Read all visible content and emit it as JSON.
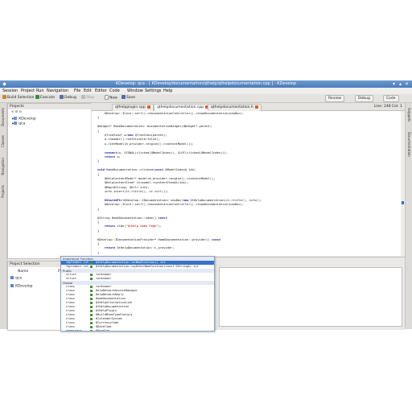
{
  "window": {
    "title": "KDevelop: qca - [ KDevelop/documentation/qthelp/qthelpdocumentation.cpp ] - KDevelop"
  },
  "menu": [
    "Session",
    "Project",
    "Run",
    "Navigation",
    "File",
    "Edit",
    "Editor",
    "Code",
    "Window",
    "Settings",
    "Help"
  ],
  "toolbar": {
    "build_selection": "Build Selection",
    "execute": "Execute",
    "debug": "Debug",
    "stop": "Stop",
    "new": "New",
    "save": "Save",
    "review": "Review",
    "debug_area": "Debug",
    "code_area": "Code"
  },
  "left_dock_tabs": [
    "Documents",
    "Classes",
    "Navigation",
    "Projects"
  ],
  "right_dock_tabs": [
    "Snippets",
    "Documentation"
  ],
  "projects": {
    "title": "Projects",
    "items": [
      "KDevelop",
      "qca"
    ]
  },
  "project_selection": {
    "title": "Project Selection",
    "col_name": "Name",
    "col_path": "Path",
    "rows": [
      "qca",
      "KDevelop"
    ]
  },
  "tabs": [
    {
      "label": "qthelpplugin.cpp"
    },
    {
      "label": "qthelpdocumentation.cpp"
    },
    {
      "label": "qthelpdocumentation.h"
    }
  ],
  "line_info": "Line: 248 Col: 1",
  "code": [
    "    KDevelop::ICore::self()->documentationController()->showDocumentation(newDoc);",
    "}",
    "",
    "QWidget* HomeDocumentation::documentationWidget(QWidget* parent)",
    "{",
    "    QTreeView* w=new QTreeView(parent);",
    "    w->header()->setVisible(false);",
    "    w->setModel(m_provider->engine()->contentModel());",
    "",
    "    connect(w, SIGNAL(clicked(QModelIndex)), SLOT(clicked(QModelIndex)));",
    "    return w;",
    "}",
    "",
    "void HomeDocumentation::clicked(const QModelIndex& idx)",
    "{",
    "    QHelpContentModel* model=m_provider->engine()->contentModel();",
    "    QHelpContentItem* it=model->contentItemAt(idx);",
    "    QMap<QString, QUrl> info;",
    "    info.insert(it->title(), it->url());",
    "",
    "    KSharedPtr<KDevelop::IDocumentation> newDoc(new QtHelpDocumentation(it->title(), info));",
    "    KDevelop::ICore::self()->documentationController()->showDocumentation(newDoc);",
    "}",
    "",
    "QString HomeDocumentation::name() const",
    "{",
    "    return i18n(\"QtHelp Home Page\");",
    "}",
    "",
    "KDevelop::IDocumentationProvider* HomeDocumentation::provider() const",
    "{",
    "    return QtHelpDocumentation::s_provider;",
    "}"
  ],
  "completion": {
    "sections": [
      "Implement Function",
      "Public",
      "Global"
    ],
    "impl_rows": [
      {
        "kind": "Implement int",
        "name": "QtHelpDocumentation::mrNewFunction() int"
      },
      {
        "kind": "Implement int",
        "name": "QtHelpDocumentation::myOtherNewFunction(const QString&) int"
      }
    ],
    "public_rows": [
      {
        "kind": "struct",
        "name": "<unknown>"
      },
      {
        "kind": "struct",
        "name": "<unknown>"
      }
    ],
    "global_rows": [
      {
        "kind": "class",
        "name": "<unknown>"
      },
      {
        "kind": "class",
        "name": "HelpNetworkAccessManager"
      },
      {
        "kind": "class",
        "name": "HelpNetworkReply"
      },
      {
        "kind": "class",
        "name": "HomeDocumentation"
      },
      {
        "kind": "class",
        "name": "QtHelpAlternativeLink"
      },
      {
        "kind": "class",
        "name": "QtHelpDocumentation"
      },
      {
        "kind": "class",
        "name": "QtHelpPlugin"
      },
      {
        "kind": "class",
        "name": "KBuildMimeTypeFactory"
      },
      {
        "kind": "class",
        "name": "KCalendarSystem"
      },
      {
        "kind": "class",
        "name": "KCurrencyCode"
      },
      {
        "kind": "class",
        "name": "KDateTime"
      },
      {
        "kind": "namespace",
        "name": "KDevelop"
      }
    ]
  },
  "colors": {
    "titlebar": "#4a7ab8",
    "selection": "#3874c7",
    "keyword": "#1a1a8f",
    "string": "#bf0303"
  }
}
